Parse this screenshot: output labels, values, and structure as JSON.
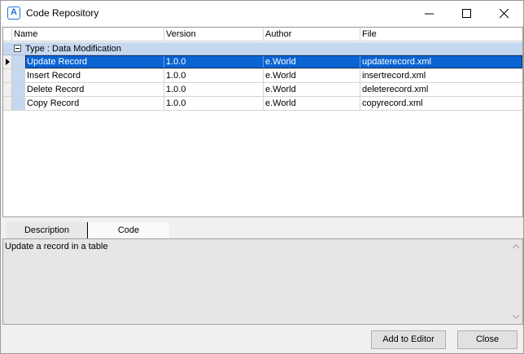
{
  "window": {
    "title": "Code Repository",
    "icon": "app-logo-icon"
  },
  "grid": {
    "columns": [
      "Name",
      "Version",
      "Author",
      "File"
    ],
    "group": {
      "label": "Type : Data Modification"
    },
    "rows": [
      {
        "name": "Update Record",
        "version": "1.0.0",
        "author": "e.World",
        "file": "updaterecord.xml",
        "selected": true
      },
      {
        "name": "Insert Record",
        "version": "1.0.0",
        "author": "e.World",
        "file": "insertrecord.xml",
        "selected": false
      },
      {
        "name": "Delete Record",
        "version": "1.0.0",
        "author": "e.World",
        "file": "deleterecord.xml",
        "selected": false
      },
      {
        "name": "Copy Record",
        "version": "1.0.0",
        "author": "e.World",
        "file": "copyrecord.xml",
        "selected": false
      }
    ]
  },
  "tabs": {
    "description": "Description",
    "code": "Code",
    "active": "Description"
  },
  "description": {
    "text": "Update a record in a table"
  },
  "buttons": {
    "add_to_editor": "Add to Editor",
    "close": "Close"
  },
  "colors": {
    "selection": "#0a64d4",
    "group_band": "#c6d8ef",
    "accent_icon": "#1a73d6"
  }
}
